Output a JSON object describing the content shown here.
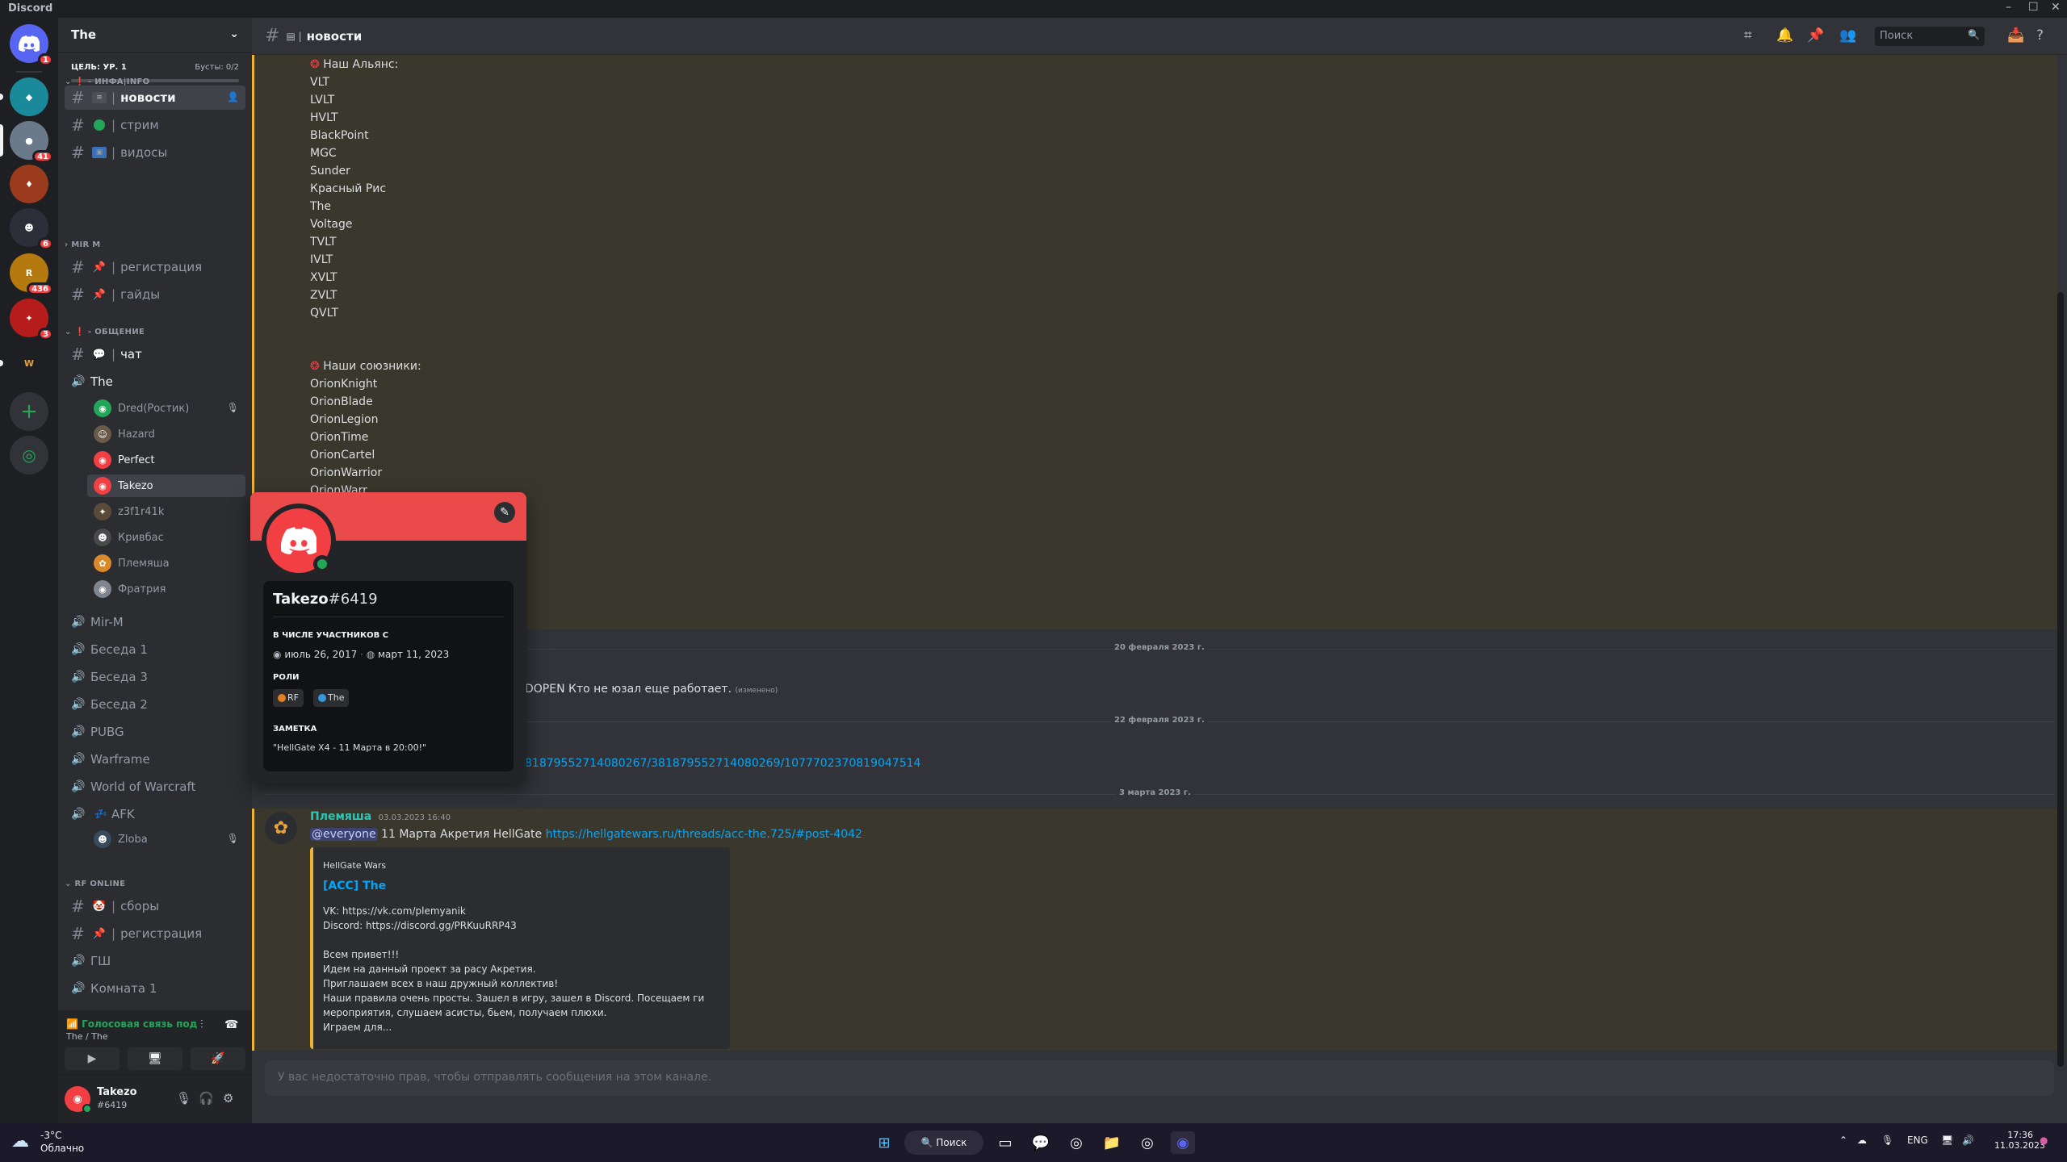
{
  "window": {
    "title": "Discord"
  },
  "servers": [
    {
      "name": "home-icon",
      "badge": "1",
      "color": "#5865f2"
    },
    {
      "name": "server-1",
      "badge": "",
      "color": "#1a8a9a"
    },
    {
      "name": "server-2",
      "badge": "41",
      "color": "#6a7a8a"
    },
    {
      "name": "server-3",
      "badge": "",
      "color": "#9b3b1e"
    },
    {
      "name": "server-4",
      "badge": "6",
      "color": "#2c2f3a"
    },
    {
      "name": "server-5",
      "badge": "436",
      "color": "#b47a10"
    },
    {
      "name": "server-6",
      "badge": "3",
      "color": "#b71c1c"
    },
    {
      "name": "server-7",
      "badge": "",
      "color": "#1e1f22"
    }
  ],
  "guild": {
    "name": "The",
    "goal_label": "ЦЕЛЬ: УР. 1",
    "boosts_label": "Бусты: 0/2"
  },
  "categories": {
    "info": "ИНФА|INFO",
    "mirm": "MIR M",
    "chat": "ОБЩЕНИЕ",
    "rf": "RF ONLINE"
  },
  "channels": {
    "news": "новости",
    "stream": "стрим",
    "videos": "видосы",
    "registration": "регистрация",
    "guides": "гайды",
    "chat": "чат",
    "voice_the": "The",
    "mirm": "Mir-M",
    "talk1": "Беседа 1",
    "talk3": "Беседа 3",
    "talk2": "Беседа 2",
    "pubg": "PUBG",
    "warframe": "Warframe",
    "wow": "World of Warcraft",
    "afk": "AFK",
    "gatherings": "сборы",
    "rf_registration": "регистрация",
    "gsh": "ГШ",
    "room1": "Комната 1"
  },
  "voice_users": {
    "dred": "Dred(Ростик)",
    "hazard": "Hazard",
    "perfect": "Perfect",
    "takezo": "Takezo",
    "z3f": "z3f1r41k",
    "krivbas": "Кривбас",
    "plem": "Племяша",
    "fratria": "Фратрия",
    "zloba": "Zloba"
  },
  "voice_panel": {
    "status": "Голосовая связь под",
    "location": "The / The"
  },
  "user": {
    "name": "Takezo",
    "tag": "#6419"
  },
  "header": {
    "channel": "новости",
    "search_placeholder": "Поиск"
  },
  "messages": {
    "alliance_title": "Наш Альянс:",
    "alliance": [
      "VLT",
      "LVLT",
      "HVLT",
      "BlackPoint",
      "MGC",
      "Sunder",
      "Красный Рис",
      "The",
      "Voltage",
      "TVLT",
      "IVLT",
      "XVLT",
      "ZVLT",
      "QVLT"
    ],
    "allies_title": "Наши союзники:",
    "allies": [
      "OrionKnight",
      "OrionBlade",
      "OrionLegion",
      "OrionTime",
      "OrionCartel",
      "OrionWarrior",
      "OrionWarr..."
    ],
    "date1": "20 февраля 2023 г.",
    "msg1_text": "DOPEN Кто не юзал еще работает.",
    "msg1_edited": "(изменено)",
    "date2": "22 февраля 2023 г.",
    "msg2_link": "81879552714080267/381879552714080269/1077702370819047514",
    "date3": "3 марта 2023 г.",
    "author": "Племяша",
    "timestamp": "03.03.2023 16:40",
    "mention": "@everyone",
    "msg3_text": " 11 Марта Акретия HellGate ",
    "msg3_link": "https://hellgatewars.ru/threads/acc-the.725/#post-4042",
    "embed": {
      "provider": "HellGate Wars",
      "title": "[ACC] The",
      "lines": [
        "VK: https://vk.com/plemyanik",
        "Discord: https://discord.gg/PRKuuRRP43",
        "",
        "Всем привет!!!",
        "Идем на данный проект за расу Акретия.",
        "Приглашаем всех в наш дружный коллектив!",
        "Наши правила очень просты. Зашел в игру, зашел в Discord. Посещаем ги",
        "мероприятия, слушаем асисты, бьем, получаем плюхи.",
        "Играем для..."
      ]
    }
  },
  "composer": {
    "placeholder": "У вас недостаточно прав, чтобы отправлять сообщения на этом канале."
  },
  "popout": {
    "username": "Takezo",
    "discriminator": "#6419",
    "member_since_label": "В ЧИСЛЕ УЧАСТНИКОВ С",
    "discord_since": "июль 26, 2017",
    "server_since": "март 11, 2023",
    "roles_label": "РОЛИ",
    "roles": [
      {
        "name": "RF",
        "color": "#e67e22"
      },
      {
        "name": "The",
        "color": "#3498db"
      }
    ],
    "note_label": "ЗАМЕТКА",
    "note": "\"HellGate X4 - 11 Марта в 20:00!\""
  },
  "taskbar": {
    "temp": "-3°C",
    "condition": "Облачно",
    "search": "Поиск",
    "lang": "ENG",
    "time": "17:36",
    "date": "11.03.2023"
  },
  "colors": {
    "accent": "#5865f2",
    "highlight_border": "#f0b232",
    "link": "#00a8fc",
    "online": "#23a55a",
    "danger": "#f23f43"
  }
}
